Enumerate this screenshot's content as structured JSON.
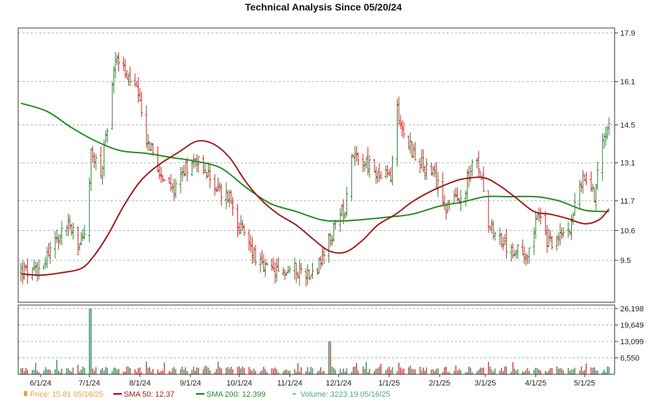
{
  "chart_data": {
    "type": "line",
    "title": "Technical Analysis Since 05/20/24",
    "x_tick_labels": [
      "6/1/24",
      "7/1/24",
      "8/1/24",
      "9/1/24",
      "10/1/24",
      "11/1/24",
      "12/1/24",
      "1/1/25",
      "2/1/25",
      "3/1/25",
      "4/1/25",
      "5/1/25"
    ],
    "x_tick_dates": [
      "2024-06-01",
      "2024-07-01",
      "2024-08-01",
      "2024-09-01",
      "2024-10-01",
      "2024-11-01",
      "2024-12-01",
      "2025-01-01",
      "2025-02-01",
      "2025-03-01",
      "2025-04-01",
      "2025-05-01"
    ],
    "price_axis": {
      "ticks": [
        "17.9",
        "16.1",
        "14.5",
        "13.1",
        "11.7",
        "10.6",
        "9.5"
      ],
      "ylim": [
        8.3,
        18.1
      ]
    },
    "volume_axis": {
      "ticks": [
        "26,198",
        "19,649",
        "13,099",
        "6,550"
      ],
      "ylim": [
        0,
        26198
      ]
    },
    "series": [
      {
        "name": "Price",
        "type": "ohlc",
        "color": "#2e7d2e",
        "down_color": "#cc2222",
        "anchors": [
          [
            "2024-05-20",
            9.1
          ],
          [
            "2024-05-28",
            9.0
          ],
          [
            "2024-06-05",
            9.7
          ],
          [
            "2024-06-12",
            10.4
          ],
          [
            "2024-06-18",
            10.9
          ],
          [
            "2024-06-24",
            10.0
          ],
          [
            "2024-06-30",
            10.9
          ],
          [
            "2024-07-02",
            13.5
          ],
          [
            "2024-07-08",
            12.6
          ],
          [
            "2024-07-15",
            16.0
          ],
          [
            "2024-07-18",
            17.2
          ],
          [
            "2024-07-24",
            16.2
          ],
          [
            "2024-07-29",
            16.0
          ],
          [
            "2024-08-05",
            14.0
          ],
          [
            "2024-08-12",
            13.0
          ],
          [
            "2024-08-20",
            12.0
          ],
          [
            "2024-08-28",
            12.9
          ],
          [
            "2024-09-05",
            13.3
          ],
          [
            "2024-09-12",
            12.6
          ],
          [
            "2024-09-19",
            12.0
          ],
          [
            "2024-09-25",
            11.9
          ],
          [
            "2024-10-02",
            10.6
          ],
          [
            "2024-10-08",
            10.0
          ],
          [
            "2024-10-15",
            9.2
          ],
          [
            "2024-10-25",
            9.0
          ],
          [
            "2024-11-05",
            9.2
          ],
          [
            "2024-11-12",
            9.0
          ],
          [
            "2024-11-20",
            9.4
          ],
          [
            "2024-11-28",
            10.6
          ],
          [
            "2024-12-05",
            11.5
          ],
          [
            "2024-12-09",
            13.5
          ],
          [
            "2024-12-16",
            13.2
          ],
          [
            "2024-12-26",
            12.6
          ],
          [
            "2025-01-02",
            12.6
          ],
          [
            "2025-01-06",
            15.1
          ],
          [
            "2025-01-10",
            14.2
          ],
          [
            "2025-01-18",
            13.2
          ],
          [
            "2025-01-28",
            12.6
          ],
          [
            "2025-02-05",
            11.6
          ],
          [
            "2025-02-14",
            11.7
          ],
          [
            "2025-02-22",
            13.2
          ],
          [
            "2025-02-27",
            12.6
          ],
          [
            "2025-03-03",
            11.0
          ],
          [
            "2025-03-12",
            10.0
          ],
          [
            "2025-03-20",
            9.8
          ],
          [
            "2025-03-27",
            9.8
          ],
          [
            "2025-04-02",
            11.2
          ],
          [
            "2025-04-08",
            10.2
          ],
          [
            "2025-04-14",
            10.2
          ],
          [
            "2025-04-22",
            10.8
          ],
          [
            "2025-04-29",
            12.4
          ],
          [
            "2025-05-03",
            12.6
          ],
          [
            "2025-05-07",
            11.9
          ],
          [
            "2025-05-12",
            14.0
          ],
          [
            "2025-05-16",
            14.8
          ]
        ]
      },
      {
        "name": "SMA 50",
        "type": "line",
        "color": "#a01818",
        "points": [
          [
            "2024-05-20",
            9.0
          ],
          [
            "2024-06-01",
            8.95
          ],
          [
            "2024-06-15",
            9.05
          ],
          [
            "2024-06-26",
            9.2
          ],
          [
            "2024-07-03",
            9.6
          ],
          [
            "2024-07-12",
            10.4
          ],
          [
            "2024-07-22",
            11.5
          ],
          [
            "2024-08-01",
            12.4
          ],
          [
            "2024-08-12",
            13.0
          ],
          [
            "2024-08-25",
            13.5
          ],
          [
            "2024-09-05",
            13.9
          ],
          [
            "2024-09-15",
            13.8
          ],
          [
            "2024-09-25",
            13.3
          ],
          [
            "2024-10-05",
            12.4
          ],
          [
            "2024-10-15",
            11.7
          ],
          [
            "2024-10-25",
            11.2
          ],
          [
            "2024-11-05",
            10.8
          ],
          [
            "2024-11-15",
            10.3
          ],
          [
            "2024-11-25",
            9.85
          ],
          [
            "2024-12-05",
            9.8
          ],
          [
            "2024-12-15",
            10.2
          ],
          [
            "2024-12-25",
            10.8
          ],
          [
            "2025-01-05",
            11.2
          ],
          [
            "2025-01-15",
            11.65
          ],
          [
            "2025-01-25",
            12.0
          ],
          [
            "2025-02-05",
            12.3
          ],
          [
            "2025-02-15",
            12.5
          ],
          [
            "2025-02-28",
            12.55
          ],
          [
            "2025-03-10",
            12.25
          ],
          [
            "2025-03-20",
            11.8
          ],
          [
            "2025-03-31",
            11.3
          ],
          [
            "2025-04-10",
            11.2
          ],
          [
            "2025-04-20",
            11.05
          ],
          [
            "2025-05-01",
            10.85
          ],
          [
            "2025-05-10",
            11.0
          ],
          [
            "2025-05-16",
            11.4
          ]
        ]
      },
      {
        "name": "SMA 200",
        "type": "line",
        "color": "#228b22",
        "points": [
          [
            "2024-05-20",
            15.3
          ],
          [
            "2024-06-05",
            15.0
          ],
          [
            "2024-06-20",
            14.4
          ],
          [
            "2024-07-05",
            13.9
          ],
          [
            "2024-07-20",
            13.55
          ],
          [
            "2024-08-05",
            13.45
          ],
          [
            "2024-08-20",
            13.3
          ],
          [
            "2024-09-05",
            13.15
          ],
          [
            "2024-09-20",
            12.9
          ],
          [
            "2024-10-05",
            12.2
          ],
          [
            "2024-10-20",
            11.6
          ],
          [
            "2024-11-05",
            11.3
          ],
          [
            "2024-11-20",
            11.0
          ],
          [
            "2024-12-01",
            10.95
          ],
          [
            "2024-12-15",
            11.0
          ],
          [
            "2025-01-01",
            11.1
          ],
          [
            "2025-01-15",
            11.2
          ],
          [
            "2025-02-01",
            11.5
          ],
          [
            "2025-02-15",
            11.65
          ],
          [
            "2025-03-01",
            11.85
          ],
          [
            "2025-03-15",
            11.85
          ],
          [
            "2025-04-01",
            11.85
          ],
          [
            "2025-04-15",
            11.7
          ],
          [
            "2025-05-01",
            11.35
          ],
          [
            "2025-05-16",
            11.3
          ]
        ]
      },
      {
        "name": "Volume",
        "type": "bar",
        "color": "#2e8b57",
        "down_color": "#cc3333",
        "spikes": [
          [
            "2024-07-01",
            26198
          ],
          [
            "2024-11-25",
            13099
          ]
        ]
      }
    ],
    "legend": {
      "placement": "bottom",
      "items": [
        {
          "key": "price",
          "text": "Price: 15.81  05/16/25",
          "color": "#e8a33c",
          "marker": "square"
        },
        {
          "key": "sma50",
          "text": "SMA 50: 12.37",
          "color": "#a01818",
          "marker": "line"
        },
        {
          "key": "sma200",
          "text": "SMA 200: 12.399",
          "color": "#228b22",
          "marker": "line"
        },
        {
          "key": "volume",
          "text": "Volume: 3223.19  05/16/25",
          "color": "#4aa87a",
          "marker": "dash"
        }
      ]
    },
    "grid": true
  }
}
